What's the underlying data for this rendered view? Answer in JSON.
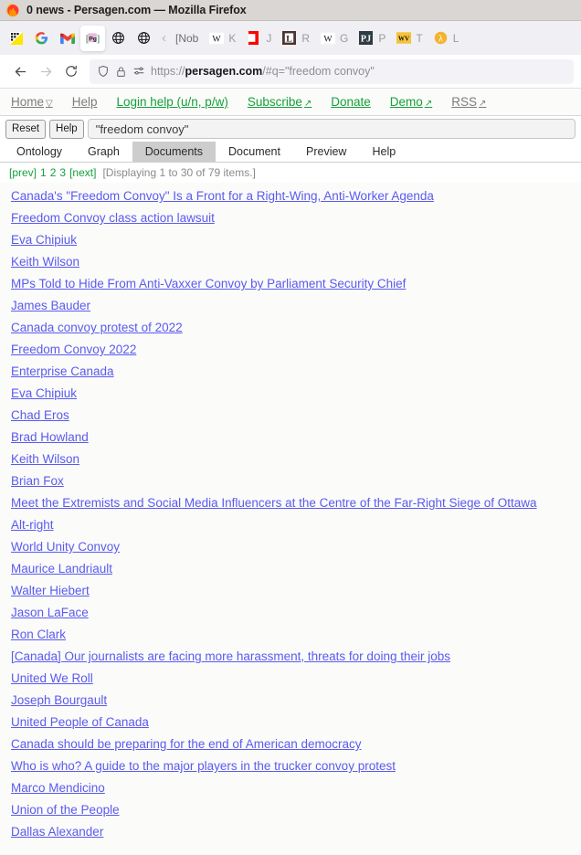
{
  "window": {
    "title": "0 news - Persagen.com — Mozilla Firefox",
    "app_icon": "firefox-icon"
  },
  "browser": {
    "bookmarks": [
      {
        "icon": "apps-grid-icon",
        "label": ""
      },
      {
        "icon": "google-icon",
        "label": ""
      },
      {
        "icon": "gmail-icon",
        "label": ""
      },
      {
        "icon": "persagen-icon",
        "label": "",
        "active": true
      },
      {
        "icon": "globe-icon",
        "label": ""
      },
      {
        "icon": "globe-icon",
        "label": ""
      },
      {
        "icon": "chevron-left-icon",
        "label": ""
      },
      {
        "icon": "nobel-icon",
        "label": "[Nob"
      },
      {
        "icon": "wikipedia-icon",
        "label": "K"
      },
      {
        "icon": "jstor-icon",
        "label": "J"
      },
      {
        "icon": "library-icon",
        "label": "R"
      },
      {
        "icon": "wikipedia-icon",
        "label": "G"
      },
      {
        "icon": "pj-icon",
        "label": "P"
      },
      {
        "icon": "wikiwand-icon",
        "label": "T"
      },
      {
        "icon": "lambda-icon",
        "label": "L"
      }
    ],
    "nav": {
      "back": "back-arrow-icon",
      "forward": "forward-arrow-icon",
      "reload": "reload-icon",
      "shield": "shield-icon",
      "lock": "lock-icon",
      "permissions": "permissions-icon"
    },
    "url": {
      "scheme": "https://",
      "host": "persagen.com",
      "path": "/#q=\"freedom convoy\""
    }
  },
  "site_nav": [
    {
      "label": "Home",
      "color": "grey",
      "caret": true,
      "external": false
    },
    {
      "label": "Help",
      "color": "grey",
      "caret": false,
      "external": false
    },
    {
      "label": "Login help (u/n, p/w)",
      "color": "green",
      "caret": false,
      "external": false
    },
    {
      "label": "Subscribe",
      "color": "green",
      "caret": false,
      "external": true
    },
    {
      "label": "Donate",
      "color": "green",
      "caret": false,
      "external": false
    },
    {
      "label": "Demo",
      "color": "green",
      "caret": false,
      "external": true
    },
    {
      "label": "RSS",
      "color": "grey",
      "caret": false,
      "external": true
    }
  ],
  "search": {
    "reset_label": "Reset",
    "help_label": "Help",
    "value": "\"freedom convoy\"",
    "placeholder": "\"freedom convoy\""
  },
  "page_tabs": [
    {
      "label": "Ontology",
      "selected": false
    },
    {
      "label": "Graph",
      "selected": false
    },
    {
      "label": "Documents",
      "selected": true
    },
    {
      "label": "Document",
      "selected": false
    },
    {
      "label": "Preview",
      "selected": false
    },
    {
      "label": "Help",
      "selected": false
    }
  ],
  "pager": {
    "prev": "[prev]",
    "pages": [
      "1",
      "2",
      "3"
    ],
    "next": "[next]",
    "status": "[Displaying 1 to 30 of 79 items.]"
  },
  "results": [
    "Canada's \"Freedom Convoy\" Is a Front for a Right-Wing, Anti-Worker Agenda",
    "Freedom Convoy class action lawsuit",
    "Eva Chipiuk",
    "Keith Wilson",
    "MPs Told to Hide From Anti-Vaxxer Convoy by Parliament Security Chief",
    "James Bauder",
    "Canada convoy protest of 2022",
    "Freedom Convoy 2022",
    "Enterprise Canada",
    "Eva Chipiuk",
    "Chad Eros",
    "Brad Howland",
    "Keith Wilson",
    "Brian Fox",
    "Meet the Extremists and Social Media Influencers at the Centre of the Far-Right Siege of Ottawa",
    "Alt-right",
    "World Unity Convoy",
    "Maurice Landriault",
    "Walter Hiebert",
    "Jason LaFace",
    "Ron Clark",
    "[Canada] Our journalists are facing more harassment, threats for doing their jobs",
    "United We Roll",
    "Joseph Bourgault",
    "United People of Canada",
    "Canada should be preparing for the end of American democracy",
    "Who is who? A guide to the major players in the trucker convoy protest",
    "Marco Mendicino",
    "Union of the People",
    "Dallas Alexander"
  ],
  "colors": {
    "link": "#5a5af0",
    "nav_green": "#15a03a",
    "nav_grey": "#7d7d7d",
    "titlebar": "#d9d6d3",
    "tabstrip": "#f0eff4",
    "selected_tab": "#cdcdcd"
  }
}
